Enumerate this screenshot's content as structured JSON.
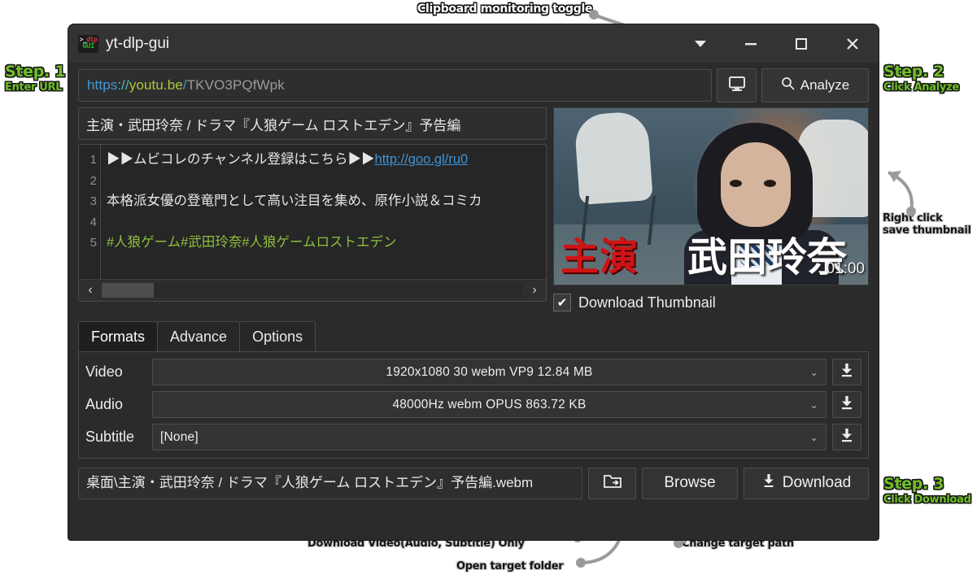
{
  "window": {
    "title": "yt-dlp-gui",
    "icon_name": "ytdlp-gui-icon",
    "icon_text_top": "dlp",
    "icon_text_bottom": "GUI",
    "controls": {
      "chevron": "chevron-down",
      "minimize": "minimize",
      "maximize": "maximize",
      "close": "close"
    }
  },
  "url_bar": {
    "scheme": "https",
    "separator": "://",
    "host": "youtu.be",
    "slash": "/",
    "path": "TKVO3PQfWpk",
    "full_value": "https://youtu.be/TKVO3PQfWpk",
    "placeholder": "https://youtu.be/TKVO3PQfWpk",
    "clipboard_toggle_name": "monitor-icon",
    "analyze_label": "Analyze",
    "analyze_icon": "search-icon"
  },
  "video": {
    "title": "主演・武田玲奈 / ドラマ『人狼ゲーム ロストエデン』予告編",
    "description_lines": [
      {
        "n": "1",
        "pre": "▶▶ムビコレのチャンネル登録はこちら▶▶",
        "link": "http://goo.gl/ru0",
        "kind": "link"
      },
      {
        "n": "2",
        "pre": "",
        "kind": "plain"
      },
      {
        "n": "3",
        "pre": "本格派女優の登竜門として高い注目を集め、原作小説＆コミカ",
        "kind": "plain"
      },
      {
        "n": "4",
        "pre": "",
        "kind": "plain"
      },
      {
        "n": "5",
        "pre": "#人狼ゲーム#武田玲奈#人狼ゲームロストエデン",
        "kind": "tag"
      }
    ],
    "scrollbar": {
      "left_arrow": "‹",
      "right_arrow": "›"
    }
  },
  "thumbnail": {
    "overlay_red_text": "主演",
    "overlay_white_text": "武田玲奈",
    "duration": "01:00",
    "checkbox_checked": true,
    "checkbox_mark": "✔",
    "checkbox_label": "Download Thumbnail"
  },
  "tabs": [
    {
      "label": "Formats",
      "active": true
    },
    {
      "label": "Advance",
      "active": false
    },
    {
      "label": "Options",
      "active": false
    }
  ],
  "formats": {
    "rows": [
      {
        "label": "Video",
        "value": "1920x1080  30  webm    VP9    12.84 MB",
        "align": "center",
        "dl_icon": "download-icon"
      },
      {
        "label": "Audio",
        "value": "48000Hz         webm  OPUS  863.72 KB",
        "align": "center",
        "dl_icon": "download-icon"
      },
      {
        "label": "Subtitle",
        "value": "[None]",
        "align": "left",
        "dl_icon": "download-icon"
      }
    ],
    "caret": "⌄"
  },
  "bottom": {
    "path_value": "桌面\\主演・武田玲奈 / ドラマ『人狼ゲーム ロストエデン』予告編.webm",
    "open_folder_icon": "folder-open-icon",
    "browse_label": "Browse",
    "download_label": "Download",
    "download_icon": "download-icon"
  },
  "annotations": {
    "step1": {
      "title": "Step. 1",
      "sub": "Enter URL"
    },
    "step2": {
      "title": "Step. 2",
      "sub": "Click Analyze"
    },
    "step3": {
      "title": "Step. 3",
      "sub": "Click Download"
    },
    "clipboard": "Clipboard monitoring toggle",
    "right_click": {
      "line1": "Right click",
      "line2": "save thumbnail"
    },
    "dl_only": "Download Video(Audio, Subtitle) Only",
    "open_folder": "Open target folder",
    "change_path": "Change target path"
  },
  "colors": {
    "accent_green": "#6fbf26",
    "window_bg": "#2b2b2b",
    "titlebar_bg": "#333333",
    "link_blue": "#3d93d8",
    "tag_green": "#8fbf3d",
    "url_host": "#a8c83c",
    "url_scheme": "#3e9ad6"
  }
}
